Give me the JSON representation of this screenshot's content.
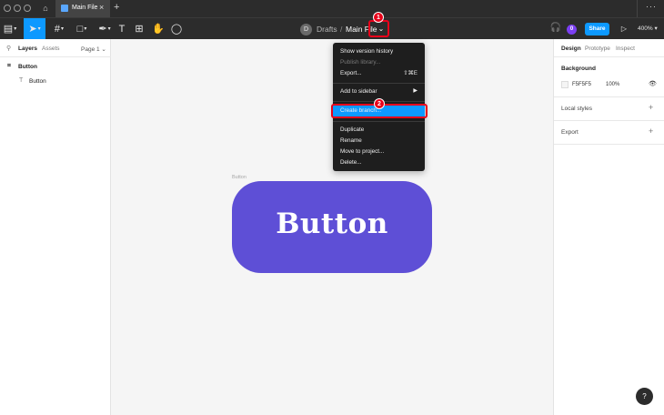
{
  "tabbar": {
    "file_tab_title": "Main File",
    "close_glyph": "×",
    "new_tab_glyph": "+",
    "more_glyph": "···"
  },
  "toolbar": {
    "breadcrumb": {
      "avatar_letter": "D",
      "project": "Drafts",
      "separator": "/",
      "file": "Main File",
      "chevron": "⌄"
    },
    "share_label": "Share",
    "user_initial": "0",
    "zoom": "400%",
    "accent_color": "#0d99ff"
  },
  "left_panel": {
    "tabs": {
      "layers": "Layers",
      "assets": "Assets"
    },
    "page": "Page 1 ⌄",
    "layers": [
      {
        "icon": "frame-icon",
        "label": "Button"
      },
      {
        "icon": "text-icon",
        "label": "Button"
      }
    ]
  },
  "canvas": {
    "frame_label": "Button",
    "button_text": "Button",
    "button_color": "#5e4fd6",
    "background_color": "#f5f5f5"
  },
  "menu": {
    "items": [
      {
        "label": "Show version history",
        "shortcut": "",
        "disabled": false
      },
      {
        "label": "Publish library...",
        "shortcut": "",
        "disabled": true
      },
      {
        "label": "Export...",
        "shortcut": "⇧⌘E",
        "disabled": false
      },
      {
        "label": "Add to sidebar",
        "shortcut": "",
        "submenu": true,
        "disabled": false
      },
      {
        "label": "Create branch...",
        "shortcut": "",
        "disabled": false,
        "highlighted": true
      },
      {
        "label": "Duplicate",
        "shortcut": "",
        "disabled": false
      },
      {
        "label": "Rename",
        "shortcut": "",
        "disabled": false
      },
      {
        "label": "Move to project...",
        "shortcut": "",
        "disabled": false
      },
      {
        "label": "Delete...",
        "shortcut": "",
        "disabled": false
      }
    ]
  },
  "right_panel": {
    "tabs": {
      "design": "Design",
      "prototype": "Prototype",
      "inspect": "Inspect"
    },
    "background": {
      "title": "Background",
      "hex": "F5F5F5",
      "opacity": "100%"
    },
    "local_styles": "Local styles",
    "export": "Export",
    "plus_glyph": "+"
  },
  "annotations": {
    "badge_1": "1",
    "badge_2": "2",
    "highlight_color": "#e8001a"
  },
  "help_label": "?"
}
